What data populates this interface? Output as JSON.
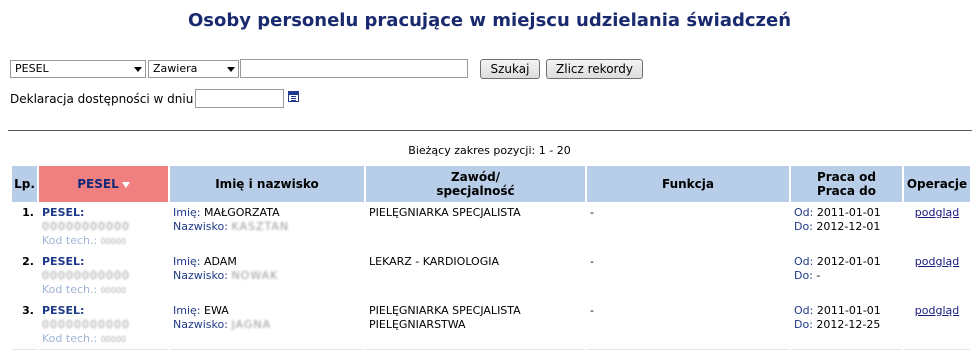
{
  "page_title": "Osoby personelu pracujące w miejscu udzielania świadczeń",
  "filter": {
    "field_select": "PESEL",
    "op_select": "Zawiera",
    "search_value": "",
    "search_button": "Szukaj",
    "count_button": "Zlicz rekordy",
    "date_label": "Deklaracja dostępności w dniu",
    "date_value": ""
  },
  "range_text": "Bieżący zakres pozycji: 1 - 20",
  "table": {
    "headers": {
      "lp": "Lp.",
      "pesel": "PESEL",
      "name": "Imię i nazwisko",
      "occupation_1": "Zawód/",
      "occupation_2": "specjalność",
      "function": "Funkcja",
      "work_1": "Praca od",
      "work_2": "Praca do",
      "operations": "Operacje"
    },
    "labels": {
      "pesel": "PESEL:",
      "kod": "Kod tech.:",
      "imie": "Imię:",
      "nazwisko": "Nazwisko:",
      "od": "Od:",
      "do": "Do:"
    },
    "rows": [
      {
        "lp": "1.",
        "pesel": "00000000000",
        "kod": "00000",
        "first_name": "MAŁGORZATA",
        "last_name": "KASZTAN",
        "occupation_1": "PIELĘGNIARKA SPECJALISTA",
        "occupation_2": "",
        "function": "-",
        "from": "2011-01-01",
        "to": "2012-12-01",
        "op": "podgląd"
      },
      {
        "lp": "2.",
        "pesel": "00000000000",
        "kod": "00000",
        "first_name": "ADAM",
        "last_name": "NOWAK",
        "occupation_1": "LEKARZ - KARDIOLOGIA",
        "occupation_2": "",
        "function": "-",
        "from": "2012-01-01",
        "to": "-",
        "op": "podgląd"
      },
      {
        "lp": "3.",
        "pesel": "00000000000",
        "kod": "00000",
        "first_name": "EWA",
        "last_name": "JAGNA",
        "occupation_1": "PIELĘGNIARKA SPECJALISTA",
        "occupation_2": "PIELĘGNIARSTWA",
        "function": "-",
        "from": "2011-01-01",
        "to": "2012-12-25",
        "op": "podgląd"
      }
    ]
  }
}
